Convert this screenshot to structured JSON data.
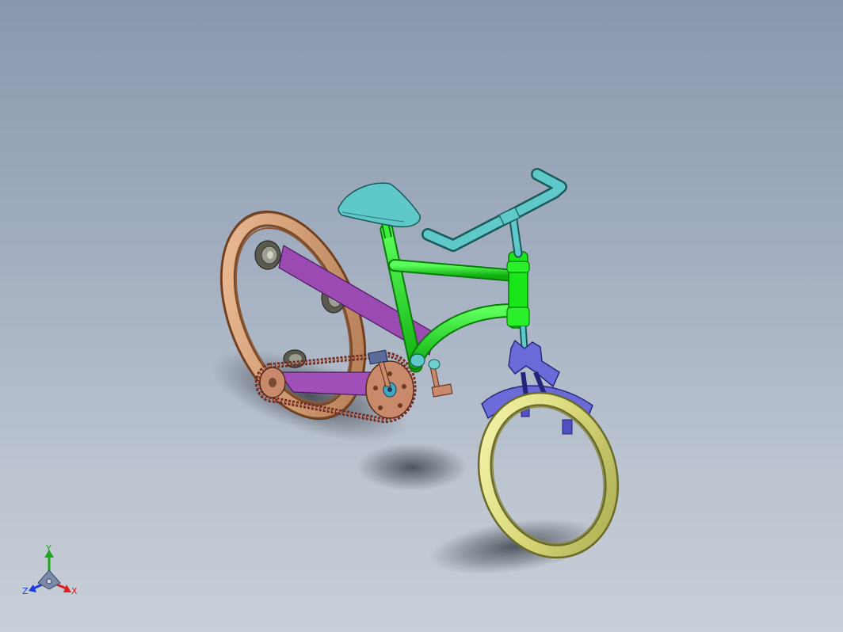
{
  "viewport": {
    "background_top": "#8898ad",
    "background_bottom": "#c9cfd8"
  },
  "model": {
    "colors": {
      "frame": "#19e619",
      "frame_edge": "#0a7a0a",
      "seat": "#5fc8c8",
      "handlebar": "#5fc8c8",
      "rear_wheel": "#d9a27a",
      "front_wheel": "#e4e48c",
      "fork": "#6a6ad8",
      "chain_guard": "#9a4ab0",
      "chain": "#b06a5a",
      "sprocket": "#c88a6a",
      "idler_roller": "#8a8a80"
    }
  },
  "triad": {
    "x_label": "X",
    "y_label": "Y",
    "z_label": "Z",
    "x_color": "#e01c1c",
    "y_color": "#1ca81c",
    "z_color": "#1c3ce0"
  }
}
